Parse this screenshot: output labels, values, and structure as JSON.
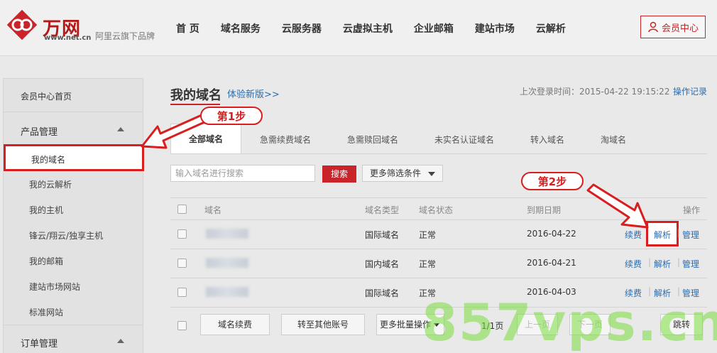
{
  "brand": {
    "name": "万网",
    "url": "www.net.cn",
    "tagline": "阿里云旗下品牌",
    "accent": "#c8242a"
  },
  "nav": {
    "items": [
      "首 页",
      "域名服务",
      "云服务器",
      "云虚拟主机",
      "企业邮箱",
      "建站市场",
      "云解析"
    ],
    "member_center": "会员中心"
  },
  "sidebar": {
    "home": "会员中心首页",
    "group_product": "产品管理",
    "items": [
      "我的域名",
      "我的云解析",
      "我的主机",
      "锋云/翔云/独享主机",
      "我的邮箱",
      "建站市场网站",
      "标准网站"
    ],
    "group_order": "订单管理"
  },
  "main": {
    "title": "我的域名",
    "new_version": "体验新版>>",
    "last_login": "上次登录时间：2015-04-22 19:15:22",
    "op_log": "操作记录",
    "tabs": [
      "全部域名",
      "急需续费域名",
      "急需赎回域名",
      "未实名认证域名",
      "转入域名",
      "淘域名"
    ],
    "search_placeholder": "输入域名进行搜索",
    "search_button": "搜索",
    "filter_button": "更多筛选条件"
  },
  "table": {
    "headers": {
      "domain": "域名",
      "type": "域名类型",
      "status": "域名状态",
      "expire": "到期日期",
      "ops": "操作"
    },
    "rows": [
      {
        "type": "国际域名",
        "status": "正常",
        "expire": "2016-04-22"
      },
      {
        "type": "国内域名",
        "status": "正常",
        "expire": "2016-04-21"
      },
      {
        "type": "国际域名",
        "status": "正常",
        "expire": "2016-04-03"
      }
    ],
    "op_renew": "续费",
    "op_dns": "解析",
    "op_manage": "管理"
  },
  "bottom": {
    "renew": "域名续费",
    "transfer": "转至其他账号",
    "batch": "更多批量操作",
    "pages": "1/1页",
    "prev": "上一页",
    "next": "下一页",
    "jump": "跳转"
  },
  "annotations": {
    "step1": "第1步",
    "step2": "第2步",
    "highlight": "#d81e1e"
  },
  "watermark": "857vps.cn"
}
